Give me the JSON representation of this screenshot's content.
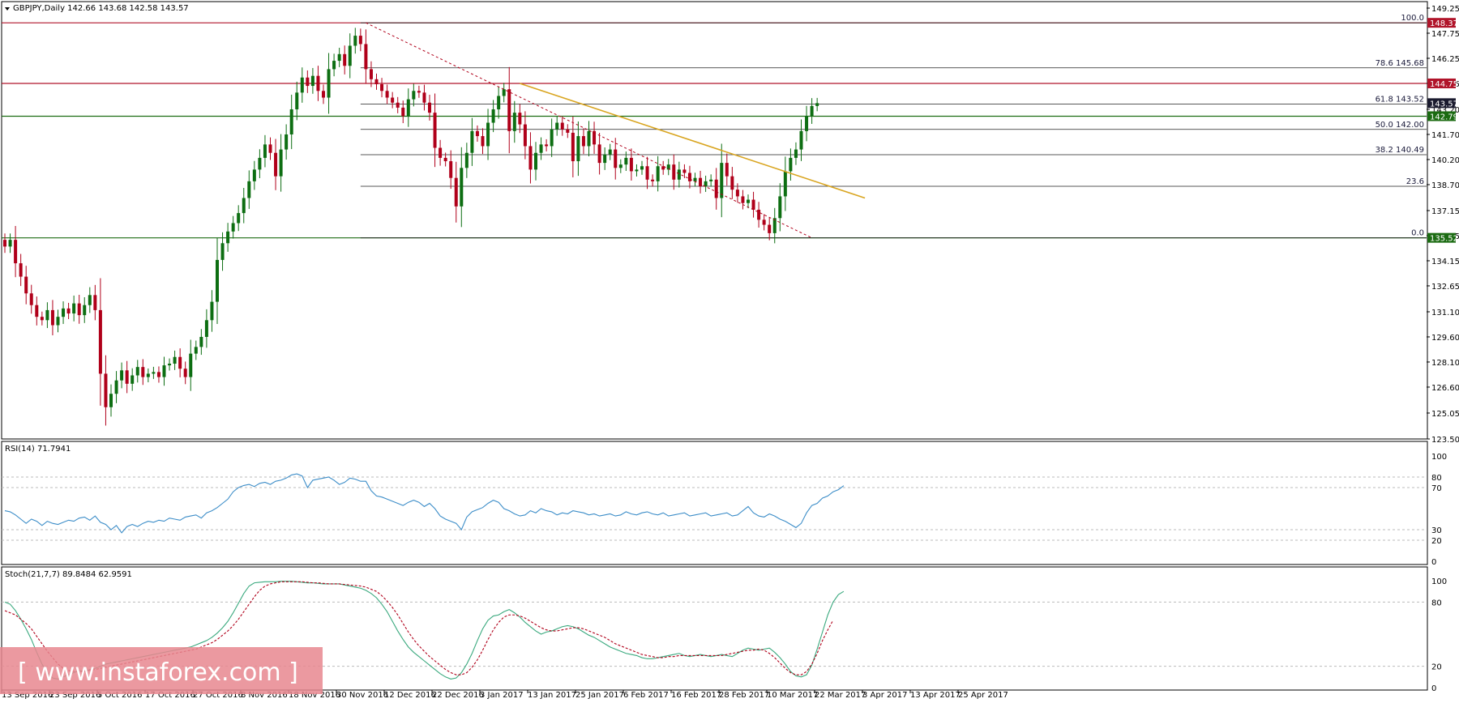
{
  "header": {
    "title": "GBPJPY,Daily  142.66 143.68 142.58 143.57",
    "menu_icon": "triangle-down-icon"
  },
  "colors": {
    "bull_candle": "#0d6e12",
    "bear_candle": "#b0001a",
    "rsi_line": "#3c8dc8",
    "stoch_main": "#3aa97e",
    "stoch_signal": "#b0001a",
    "trendline": "#d9a520",
    "tag_red": "#b0142a",
    "tag_green": "#1b6b12",
    "tag_dark": "#1a1a2e",
    "watermark_bg": "#e8878f"
  },
  "chart_data": [
    {
      "type": "candlestick",
      "title": "GBPJPY,Daily  142.66 143.68 142.58 143.57",
      "ylim": [
        123.5,
        149.25
      ],
      "y_ticks": [
        "149.25",
        "147.75",
        "146.25",
        "144.75",
        "143.20",
        "141.70",
        "140.20",
        "138.70",
        "137.15",
        "135.65",
        "134.15",
        "132.65",
        "131.10",
        "129.60",
        "128.10",
        "126.60",
        "125.05",
        "123.50"
      ],
      "x_ticks": [
        "13 Sep 2016",
        "23 Sep 2016",
        "5 Oct 2016",
        "17 Oct 2016",
        "27 Oct 2016",
        "8 Nov 2016",
        "18 Nov 2016",
        "30 Nov 2016",
        "12 Dec 2016",
        "22 Dec 2016",
        "3 Jan 2017",
        "13 Jan 2017",
        "25 Jan 2017",
        "6 Feb 2017",
        "16 Feb 2017",
        "28 Feb 2017",
        "10 Mar 2017",
        "22 Mar 2017",
        "3 Apr 2017",
        "13 Apr 2017",
        "25 Apr 2017"
      ],
      "close_series": [
        135.0,
        135.4,
        134.0,
        133.2,
        132.2,
        131.5,
        130.8,
        130.6,
        131.2,
        130.3,
        130.8,
        131.3,
        131.0,
        131.6,
        130.9,
        131.5,
        132.1,
        131.2,
        127.4,
        125.4,
        126.2,
        127.0,
        127.6,
        126.8,
        127.3,
        127.8,
        127.2,
        127.4,
        127.5,
        127.2,
        127.9,
        128.0,
        128.4,
        127.7,
        127.2,
        128.6,
        129.0,
        129.6,
        130.6,
        131.7,
        134.2,
        135.2,
        135.9,
        136.4,
        137.0,
        137.9,
        138.9,
        139.6,
        140.3,
        141.1,
        140.6,
        139.2,
        140.8,
        141.7,
        143.2,
        144.2,
        145.1,
        144.6,
        145.2,
        144.3,
        143.9,
        145.6,
        146.1,
        146.5,
        145.8,
        147.0,
        147.6,
        147.1,
        145.6,
        145.0,
        144.7,
        144.3,
        143.9,
        143.6,
        143.3,
        142.8,
        143.8,
        144.3,
        144.2,
        143.6,
        143.0,
        140.9,
        140.3,
        140.1,
        139.1,
        137.4,
        139.7,
        140.6,
        141.9,
        141.6,
        141.0,
        142.4,
        143.2,
        144.0,
        144.4,
        141.9,
        143.0,
        142.3,
        141.0,
        139.6,
        140.6,
        141.1,
        141.0,
        142.0,
        142.4,
        142.0,
        141.8,
        140.1,
        141.6,
        141.0,
        141.9,
        141.1,
        140.0,
        140.5,
        140.8,
        139.7,
        139.9,
        140.3,
        139.5,
        139.6,
        139.8,
        139.0,
        138.9,
        139.8,
        139.6,
        139.9,
        139.0,
        139.6,
        139.4,
        138.9,
        139.1,
        138.6,
        138.9,
        139.0,
        137.9,
        140.0,
        139.2,
        138.4,
        138.0,
        137.6,
        137.8,
        137.2,
        136.6,
        136.3,
        135.8,
        136.7,
        138.0,
        139.5,
        140.3,
        140.8,
        141.9,
        142.8,
        143.4,
        143.57
      ],
      "horizontal_lines": [
        {
          "name": "resistance-148",
          "value": 148.37,
          "color": "#b0142a",
          "label": "148.37"
        },
        {
          "name": "resistance-144",
          "value": 144.75,
          "color": "#b0142a",
          "label": "144.75"
        },
        {
          "name": "support-142",
          "value": 142.79,
          "color": "#1b6b12",
          "label": "142.79"
        },
        {
          "name": "support-135",
          "value": 135.52,
          "color": "#1b6b12",
          "label": "135.52"
        }
      ],
      "price_tags": [
        {
          "value": 148.37,
          "label": "148.37",
          "color": "#b0142a"
        },
        {
          "value": 144.75,
          "label": "144.75",
          "color": "#b0142a"
        },
        {
          "value": 143.57,
          "label": "143.57",
          "color": "#1a1a2e"
        },
        {
          "value": 142.79,
          "label": "142.79",
          "color": "#1b6b12"
        },
        {
          "value": 135.52,
          "label": "135.52",
          "color": "#1b6b12"
        }
      ],
      "fibonacci": [
        {
          "label": "100.0",
          "value": 148.37
        },
        {
          "label": "78.6 145.68",
          "value": 145.68
        },
        {
          "label": "61.8 143.52",
          "value": 143.52
        },
        {
          "label": "50.0 142.00",
          "value": 142.0
        },
        {
          "label": "38.2 140.49",
          "value": 140.49
        },
        {
          "label": "23.6",
          "value": 138.6
        },
        {
          "label": "0.0",
          "value": 135.52
        }
      ],
      "trendlines": [
        {
          "name": "dashed-downtrend",
          "style": "dashed",
          "from": {
            "bar": 68,
            "price": 148.37
          },
          "to": {
            "bar": 152,
            "price": 135.52
          }
        },
        {
          "name": "gold-trendline",
          "style": "solid",
          "from": {
            "bar": 97,
            "price": 144.75
          },
          "to": {
            "bar": 162,
            "price": 137.9
          }
        }
      ]
    },
    {
      "type": "line",
      "title": "RSI(14) 71.7941",
      "ylim": [
        0,
        100
      ],
      "y_ticks": [
        "100",
        "80",
        "70",
        "30",
        "20",
        "0"
      ],
      "levels": [
        80,
        70,
        30,
        20
      ],
      "series": [
        {
          "name": "RSI(14)",
          "values": [
            48,
            47,
            44,
            40,
            36,
            40,
            38,
            34,
            38,
            36,
            35,
            37,
            39,
            38,
            41,
            42,
            39,
            43,
            37,
            35,
            30,
            34,
            27,
            33,
            35,
            33,
            36,
            38,
            37,
            39,
            38,
            41,
            40,
            39,
            42,
            43,
            44,
            41,
            46,
            48,
            51,
            55,
            59,
            66,
            70,
            72,
            73,
            71,
            74,
            75,
            73,
            76,
            77,
            79,
            82,
            83,
            81,
            70,
            77,
            78,
            79,
            80,
            77,
            73,
            75,
            79,
            78,
            76,
            76,
            67,
            62,
            61,
            59,
            57,
            55,
            53,
            56,
            58,
            56,
            52,
            55,
            50,
            43,
            40,
            38,
            36,
            30,
            42,
            47,
            49,
            51,
            55,
            58,
            56,
            50,
            48,
            45,
            43,
            44,
            48,
            46,
            50,
            48,
            47,
            44,
            46,
            45,
            48,
            47,
            46,
            44,
            45,
            43,
            44,
            45,
            43,
            44,
            47,
            45,
            44,
            46,
            47,
            45,
            44,
            46,
            43,
            44,
            45,
            46,
            43,
            44,
            45,
            46,
            43,
            44,
            45,
            46,
            43,
            44,
            48,
            52,
            46,
            43,
            42,
            45,
            43,
            40,
            38,
            35,
            32,
            36,
            46,
            53,
            55,
            60,
            62,
            66,
            68,
            71.79
          ]
        }
      ]
    },
    {
      "type": "line",
      "title": "Stoch(21,7,7) 89.8484 62.9591",
      "ylim": [
        0,
        100
      ],
      "y_ticks": [
        "100",
        "80",
        "20",
        "0"
      ],
      "levels": [
        80,
        20
      ],
      "series": [
        {
          "name": "Stoch main",
          "values": [
            80,
            78,
            72,
            64,
            55,
            45,
            33,
            22,
            14,
            9,
            8,
            10,
            12,
            14,
            16,
            15,
            17,
            18,
            20,
            22,
            23,
            24,
            25,
            26,
            27,
            28,
            29,
            30,
            31,
            32,
            33,
            34,
            35,
            36,
            37,
            38,
            40,
            42,
            44,
            47,
            51,
            56,
            62,
            70,
            79,
            88,
            95,
            98,
            98.5,
            99,
            99,
            99,
            99.5,
            99.5,
            99.5,
            99,
            98.5,
            98,
            98,
            97.5,
            97,
            97,
            97,
            97,
            96,
            95,
            94,
            93,
            91,
            88,
            84,
            78,
            71,
            62,
            53,
            45,
            38,
            33,
            29,
            25,
            21,
            17,
            13,
            10,
            8,
            9,
            14,
            22,
            32,
            44,
            55,
            63,
            67,
            68,
            71,
            73,
            70,
            66,
            61,
            57,
            53,
            50,
            52,
            53,
            55,
            57,
            58,
            57,
            55,
            52,
            49,
            47,
            44,
            41,
            38,
            36,
            34,
            32,
            31,
            30,
            28,
            27,
            27,
            28,
            29,
            30,
            31,
            32,
            30,
            29,
            30,
            31,
            30,
            29,
            30,
            31,
            30,
            29,
            32,
            35,
            37,
            36,
            35,
            36,
            37,
            33,
            28,
            22,
            15,
            11,
            10,
            12,
            21,
            36,
            52,
            68,
            80,
            87,
            90
          ]
        },
        {
          "name": "Stoch signal",
          "values": [
            72,
            70,
            68,
            64,
            60,
            55,
            48,
            41,
            34,
            28,
            22,
            18,
            16,
            15,
            15,
            15,
            16,
            17,
            18,
            19,
            20,
            21,
            22,
            23,
            24,
            25,
            26,
            27,
            28,
            29,
            30,
            31,
            32,
            33,
            34,
            35,
            36,
            38,
            40,
            42,
            45,
            49,
            53,
            58,
            64,
            71,
            78,
            85,
            91,
            95,
            97,
            98,
            99,
            99,
            99,
            99,
            99,
            98.5,
            98,
            98,
            97.5,
            97,
            97,
            97,
            96.5,
            96,
            95.5,
            95,
            94,
            92,
            90,
            86,
            81,
            75,
            68,
            60,
            52,
            45,
            39,
            34,
            29,
            25,
            21,
            17,
            14,
            12,
            12,
            14,
            19,
            26,
            35,
            45,
            54,
            61,
            66,
            68,
            68,
            67,
            65,
            62,
            59,
            56,
            54,
            53,
            53,
            54,
            55,
            56,
            56,
            55,
            53,
            51,
            49,
            47,
            44,
            41,
            39,
            37,
            35,
            33,
            31,
            30,
            29,
            28,
            28,
            29,
            29,
            30,
            30,
            30,
            30,
            30,
            30,
            30,
            30,
            30,
            31,
            32,
            33,
            34,
            35,
            35,
            36,
            35,
            32,
            28,
            23,
            18,
            14,
            12,
            12,
            15,
            22,
            32,
            44,
            54,
            63
          ]
        }
      ]
    }
  ],
  "watermark": {
    "text": "[ www.instaforex.com ]"
  }
}
